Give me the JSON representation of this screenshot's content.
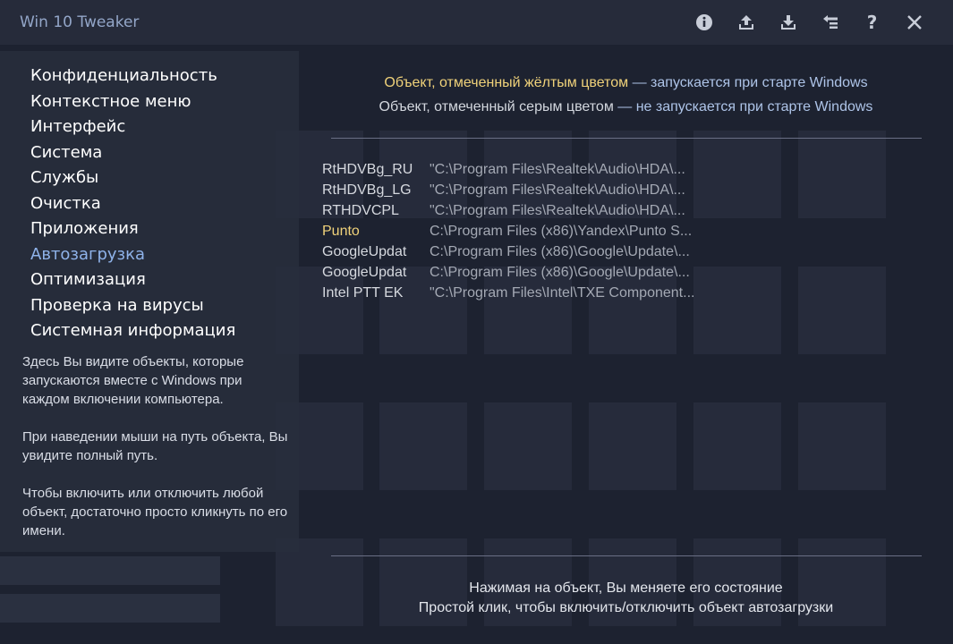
{
  "app": {
    "title": "Win 10 Tweaker"
  },
  "toolbar": {
    "icons": [
      "info-icon",
      "upload-icon",
      "download-icon",
      "settings-list-icon",
      "help-icon",
      "close-icon"
    ],
    "help_label": "?"
  },
  "sidebar": {
    "items": [
      {
        "label": "Конфиденциальность"
      },
      {
        "label": "Контекстное меню"
      },
      {
        "label": "Интерфейс"
      },
      {
        "label": "Система"
      },
      {
        "label": "Службы"
      },
      {
        "label": "Очистка"
      },
      {
        "label": "Приложения"
      },
      {
        "label": "Автозагрузка",
        "active": true
      },
      {
        "label": "Оптимизация"
      },
      {
        "label": "Проверка на вирусы"
      },
      {
        "label": "Системная информация"
      }
    ],
    "help": [
      "Здесь Вы видите объекты, которые запускаются вместе с Windows при каждом включении компьютера.",
      "При наведении мыши на путь объекта, Вы увидите полный путь.",
      "Чтобы включить или отключить любой объект, достаточно просто кликнуть по его имени."
    ]
  },
  "legend": {
    "yellow_text": "Объект, отмеченный жёлтым цветом",
    "yellow_rest": " — запускается при старте Windows",
    "gray_text": "Объект, отмеченный серым цветом",
    "gray_rest": " — не запускается при старте Windows"
  },
  "startup_items": [
    {
      "name": "RtHDVBg_RU",
      "path": "\"C:\\Program Files\\Realtek\\Audio\\HDA\\...",
      "enabled": false
    },
    {
      "name": "RtHDVBg_LG",
      "path": "\"C:\\Program Files\\Realtek\\Audio\\HDA\\...",
      "enabled": false
    },
    {
      "name": "RTHDVCPL",
      "path": "\"C:\\Program Files\\Realtek\\Audio\\HDA\\...",
      "enabled": false
    },
    {
      "name": "Punto",
      "path": "C:\\Program Files (x86)\\Yandex\\Punto S...",
      "enabled": true
    },
    {
      "name": "GoogleUpdat",
      "path": "C:\\Program Files (x86)\\Google\\Update\\...",
      "enabled": false
    },
    {
      "name": "GoogleUpdat",
      "path": "C:\\Program Files (x86)\\Google\\Update\\...",
      "enabled": false
    },
    {
      "name": "Intel PTT EK",
      "path": "\"C:\\Program Files\\Intel\\TXE Component...",
      "enabled": false
    }
  ],
  "footer": {
    "line1": "Нажимая на объект, Вы меняете его состояние",
    "line2": "Простой клик, чтобы включить/отключить объект автозагрузки"
  },
  "colors": {
    "background": "#1d2230",
    "enabled": "#f0d27a",
    "disabled": "#d6d9df",
    "active_nav": "#8fb3ea"
  }
}
